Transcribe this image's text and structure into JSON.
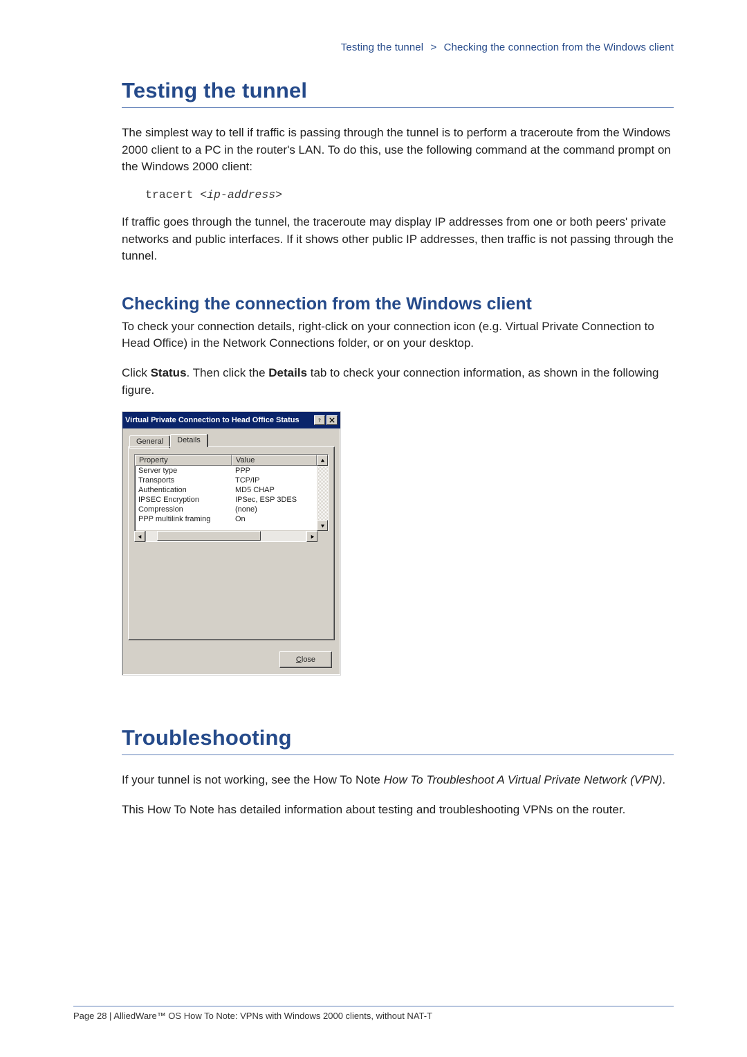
{
  "breadcrumb": {
    "left": "Testing the tunnel",
    "sep": ">",
    "right": "Checking the connection from the Windows client"
  },
  "section1": {
    "heading": "Testing the tunnel",
    "para1": "The simplest way to tell if traffic is passing through the tunnel is to perform a traceroute from the Windows 2000 client to a PC in the router's LAN. To do this, use the following command at the command prompt on the Windows 2000 client:",
    "code_cmd": "tracert ",
    "code_arg": "<ip-address>",
    "para2": "If traffic goes through the tunnel, the traceroute may display IP addresses from one or both peers' private networks and public interfaces. If it shows other public IP addresses, then traffic is not passing through the tunnel."
  },
  "section2": {
    "heading": "Checking the connection from the Windows client",
    "para1": "To check your connection details, right-click on your connection icon (e.g. Virtual Private Connection to Head Office) in the Network Connections folder, or on your desktop.",
    "para2_pre": "Click ",
    "para2_b1": "Status",
    "para2_mid": ". Then click the ",
    "para2_b2": "Details",
    "para2_post": " tab to check your connection information, as shown in the following figure."
  },
  "dialog": {
    "title": "Virtual Private Connection to Head Office Status",
    "tabs": {
      "general": "General",
      "details": "Details"
    },
    "columns": {
      "property": "Property",
      "value": "Value"
    },
    "rows": [
      {
        "p": "Server type",
        "v": "PPP"
      },
      {
        "p": "Transports",
        "v": "TCP/IP"
      },
      {
        "p": "Authentication",
        "v": "MD5 CHAP"
      },
      {
        "p": "IPSEC Encryption",
        "v": "IPSec, ESP 3DES"
      },
      {
        "p": "Compression",
        "v": "(none)"
      },
      {
        "p": "PPP multilink framing",
        "v": "On"
      }
    ],
    "close_u": "C",
    "close_rest": "lose"
  },
  "section3": {
    "heading": "Troubleshooting",
    "para1_pre": "If your tunnel is not working, see the How To Note ",
    "para1_i": "How To Troubleshoot A Virtual Private Network (VPN)",
    "para1_post": ".",
    "para2": "This How To Note has detailed information about testing and troubleshooting VPNs on the router."
  },
  "footer": {
    "text": "Page 28 | AlliedWare™ OS How To Note: VPNs with Windows 2000 clients, without NAT-T"
  }
}
